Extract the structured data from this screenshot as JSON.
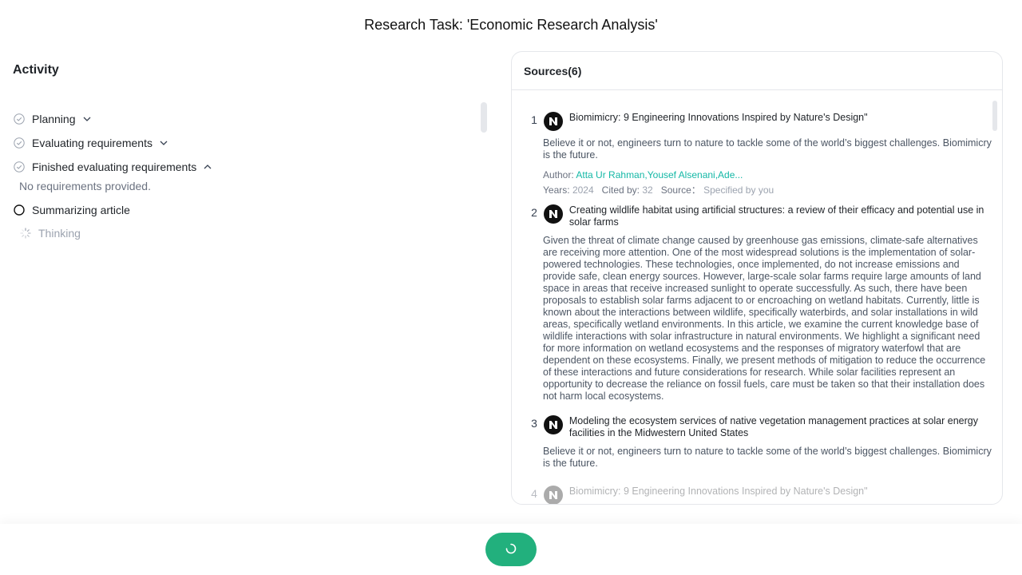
{
  "page": {
    "title": "Research Task: 'Economic Research Analysis'"
  },
  "activity": {
    "title": "Activity",
    "steps": [
      {
        "label": "Planning",
        "status": "done",
        "chevron": "down"
      },
      {
        "label": "Evaluating requirements",
        "status": "done",
        "chevron": "down"
      },
      {
        "label": "Finished evaluating requirements",
        "status": "done",
        "chevron": "up"
      },
      {
        "label": "Summarizing article",
        "status": "in-progress"
      }
    ],
    "note": "No requirements provided.",
    "thinking": "Thinking"
  },
  "sources": {
    "header": "Sources(6)",
    "items": [
      {
        "num": "1",
        "title": "Biomimicry: 9 Engineering Innovations Inspired by Nature's Design\"",
        "desc": "Believe it or not, engineers turn to nature to tackle some of the world’s biggest challenges. Biomimicry is the future.",
        "author_label": "Author:",
        "author": "Atta Ur Rahman,Yousef Alsenani,Ade...",
        "years_label": "Years:",
        "years": "2024",
        "cited_label": "Cited by:",
        "cited": "32",
        "source_label": "Source：",
        "source": "Specified by you"
      },
      {
        "num": "2",
        "title": "Creating wildlife habitat using artificial structures: a review of their efficacy and potential use in solar farms",
        "desc": "Given the threat of climate change caused by greenhouse gas emissions, climate-safe alternatives are receiving more attention. One of the most widespread solutions is the implementation of solar-powered technologies. These technologies, once implemented, do not increase emissions and provide safe, clean energy sources. However, large-scale solar farms require large amounts of land space in areas that receive increased sunlight to operate successfully. As such, there have been proposals to establish solar farms adjacent to or encroaching on wetland habitats. Currently, little is known about the interactions between wildlife, specifically waterbirds, and solar installations in wild areas, specifically wetland environments. In this article, we examine the current knowledge base of wildlife interactions with solar infrastructure in natural environments. We highlight a significant need for more information on wetland ecosystems and the responses of migratory waterfowl that are dependent on these ecosystems. Finally, we present methods of mitigation to reduce the occurrence of these interactions and future considerations for research. While solar facilities represent an opportunity to decrease the reliance on fossil fuels, care must be taken so that their installation does not harm local ecosystems."
      },
      {
        "num": "3",
        "title": "Modeling the ecosystem services of native vegetation management practices at solar energy facilities in the Midwestern United States",
        "desc": "Believe it or not, engineers turn to nature to tackle some of the world’s biggest challenges. Biomimicry is the future."
      },
      {
        "num": "4",
        "title": "Biomimicry: 9 Engineering Innovations Inspired by Nature's Design\""
      }
    ]
  },
  "controls": {
    "stop_icon": "spinner-icon",
    "accent": "#22b07d"
  }
}
